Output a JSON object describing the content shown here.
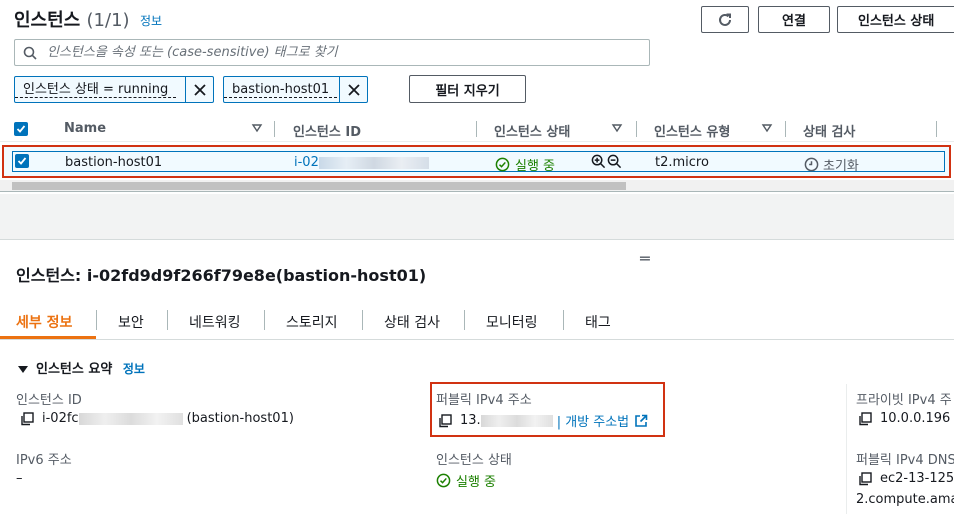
{
  "header": {
    "title": "인스턴스",
    "count": "(1/1)",
    "info": "정보",
    "buttons": {
      "connect": "연결",
      "instance_state": "인스턴스 상태"
    }
  },
  "search": {
    "placeholder": "인스턴스을 속성 또는 (case-sensitive) 태그로 찾기"
  },
  "filters": {
    "tokens": [
      "인스턴스 상태 = running",
      "bastion-host01"
    ],
    "clear_label": "필터 지우기"
  },
  "table": {
    "columns": [
      "Name",
      "인스턴스 ID",
      "인스턴스 상태",
      "인스턴스 유형",
      "상태 검사"
    ],
    "rows": [
      {
        "name": "bastion-host01",
        "instance_id_prefix": "i-02",
        "state": "실행 중",
        "type": "t2.micro",
        "check": "초기화"
      }
    ]
  },
  "detail": {
    "title": "인스턴스: i-02fd9d9f266f79e8e(bastion-host01)",
    "tabs": [
      "세부 정보",
      "보안",
      "네트워킹",
      "스토리지",
      "상태 검사",
      "모니터링",
      "태그"
    ],
    "active_tab": "세부 정보",
    "section_title": "인스턴스 요약",
    "section_info": "정보",
    "fields": {
      "instance_id_label": "인스턴스 ID",
      "instance_id_prefix": "i-02fc",
      "instance_id_suffix": "(bastion-host01)",
      "public_ipv4_label": "퍼블릭 IPv4 주소",
      "public_ipv4_prefix": "13.",
      "open_address_link": "| 개방 주소법",
      "private_ipv4_label": "프라이빗 IPv4 주",
      "private_ipv4_value": "10.0.0.196",
      "ipv6_label": "IPv6 주소",
      "ipv6_value": "–",
      "state_label": "인스턴스 상태",
      "state_value": "실행 중",
      "public_dns_label": "퍼블릭 IPv4 DNS",
      "public_dns_value_1": "ec2-13-125",
      "public_dns_value_2": "2.compute.ama"
    }
  },
  "colors": {
    "link": "#0073bb",
    "active_tab": "#ec7211",
    "running": "#1d8102",
    "highlight": "#d13212"
  }
}
